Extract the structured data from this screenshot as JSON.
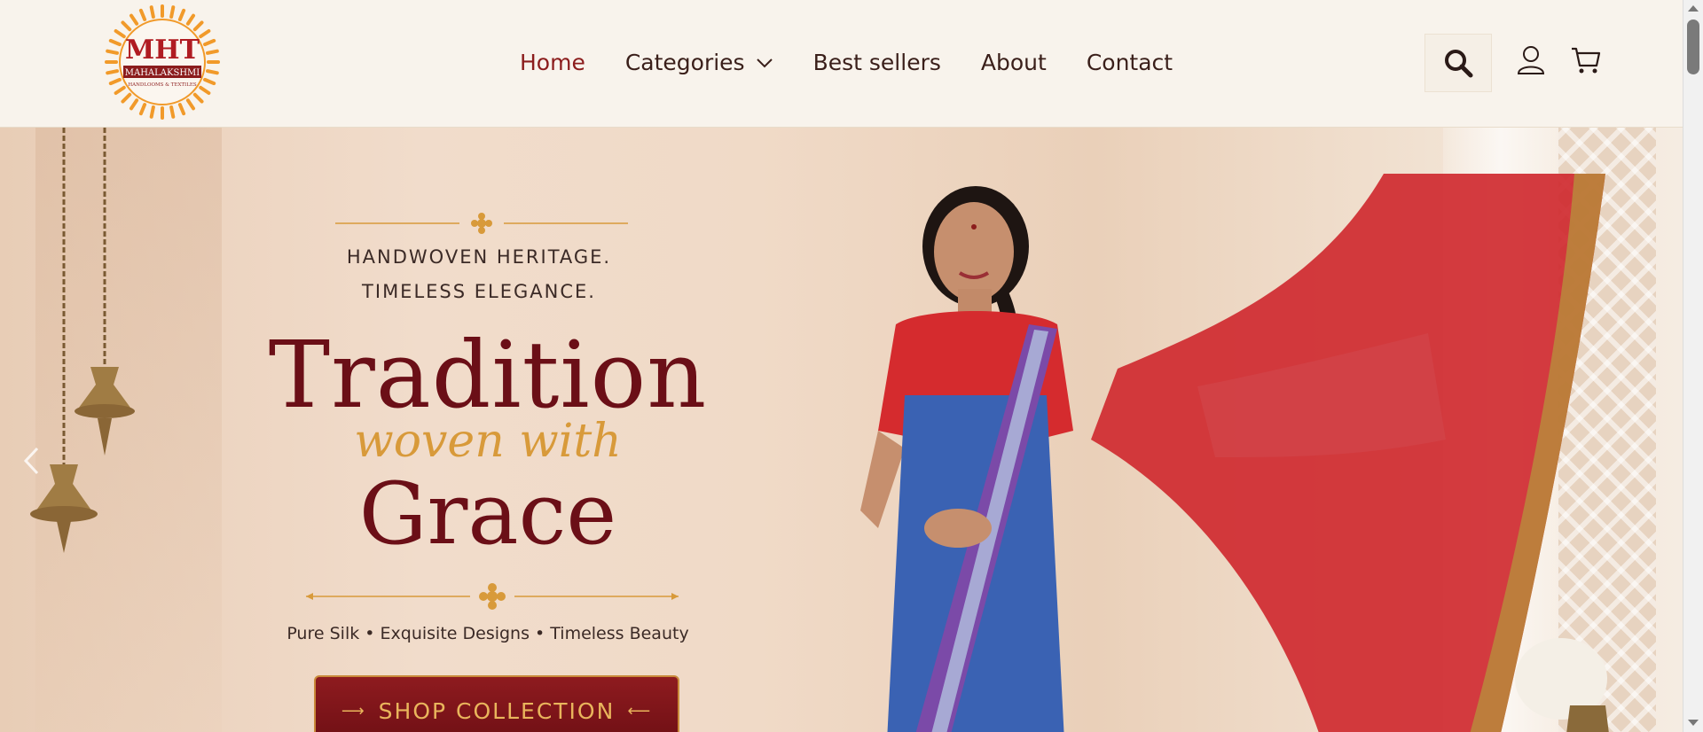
{
  "brand": {
    "logo_initials": "MHT",
    "logo_name": "MAHALAKSHMI",
    "logo_tagline": "HANDLOOMS & TEXTILES"
  },
  "nav": {
    "items": [
      {
        "label": "Home",
        "active": true
      },
      {
        "label": "Categories",
        "has_dropdown": true
      },
      {
        "label": "Best sellers"
      },
      {
        "label": "About"
      },
      {
        "label": "Contact"
      }
    ]
  },
  "header_icons": [
    "search-icon",
    "user-icon",
    "cart-icon"
  ],
  "hero": {
    "tagline_line1": "HANDWOVEN HERITAGE.",
    "tagline_line2": "TIMELESS ELEGANCE.",
    "headline_top": "Tradition",
    "headline_script": "woven with",
    "headline_bottom": "Grace",
    "subline": "Pure Silk • Exquisite Designs • Timeless Beauty",
    "cta_label": "SHOP COLLECTION"
  },
  "colors": {
    "accent": "#8b1c1c",
    "maroon": "#6b0f17",
    "gold": "#d89a3a",
    "header_bg": "#f8f3ec"
  }
}
